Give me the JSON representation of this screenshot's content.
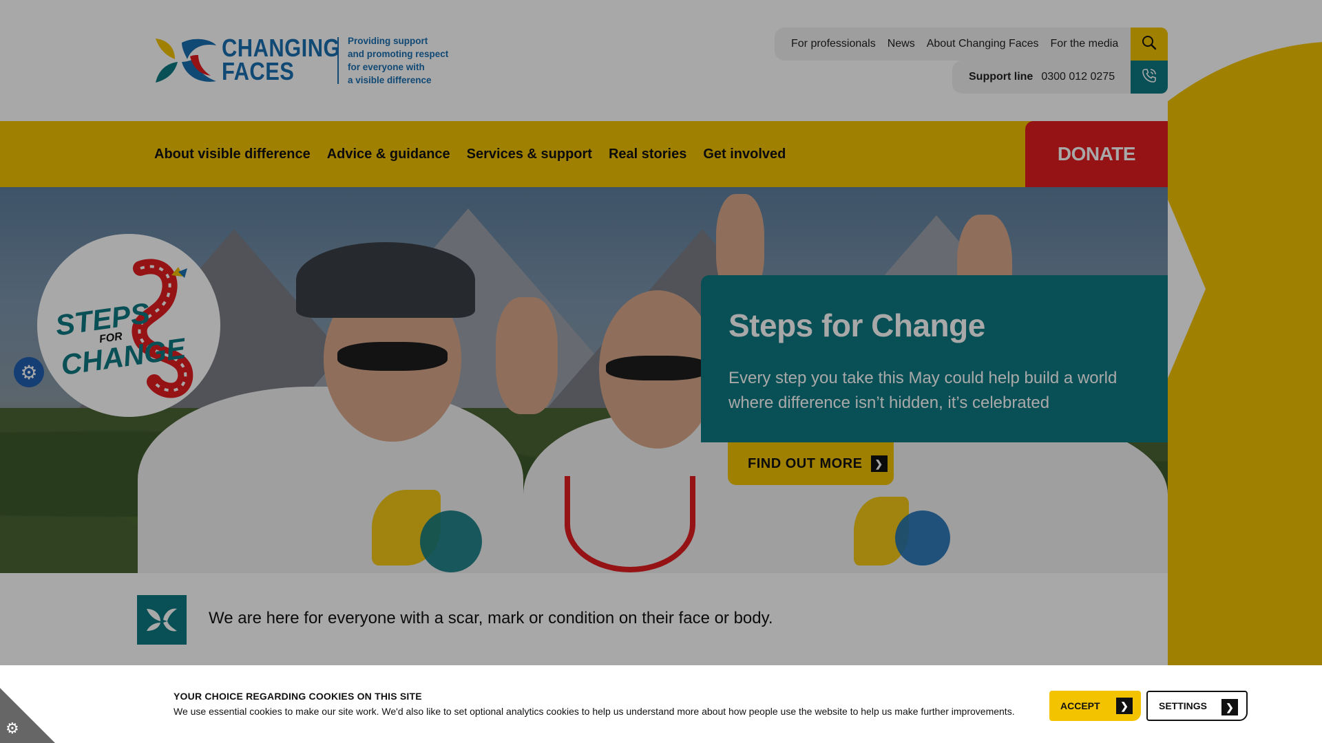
{
  "header": {
    "logo_word_1": "CHANGING",
    "logo_word_2": "FACES",
    "tagline_lines": [
      "Providing support",
      "and promoting respect",
      "for everyone with",
      "a visible difference"
    ],
    "top_links": [
      "For professionals",
      "News",
      "About Changing Faces",
      "For the media"
    ],
    "support_label": "Support line",
    "support_number": "0300 012 0275",
    "search_icon": "search-icon",
    "phone_icon": "phone-icon"
  },
  "nav": {
    "items": [
      "About visible difference",
      "Advice & guidance",
      "Services & support",
      "Real stories",
      "Get involved"
    ],
    "donate": "DONATE"
  },
  "hero": {
    "badge_line_1": "STEPS",
    "badge_line_2": "FOR",
    "badge_line_3": "CHANGE",
    "title": "Steps for Change",
    "text": "Every step you take this May could help build a world where difference isn’t hidden, it’s celebrated",
    "cta": "FIND OUT MORE"
  },
  "band": {
    "text": "We are here for everyone with a scar, mark or condition on their face or body."
  },
  "cookie": {
    "title": "YOUR CHOICE REGARDING COOKIES ON THIS SITE",
    "text": "We use essential cookies to make our site work. We'd also like to set optional analytics cookies to help us understand more about how people use the website to help us make further improvements.",
    "accept": "ACCEPT",
    "settings": "SETTINGS"
  },
  "colors": {
    "yellow": "#f3c300",
    "teal": "#0e7a83",
    "red": "#e21c21",
    "blue": "#1a6fb2"
  }
}
